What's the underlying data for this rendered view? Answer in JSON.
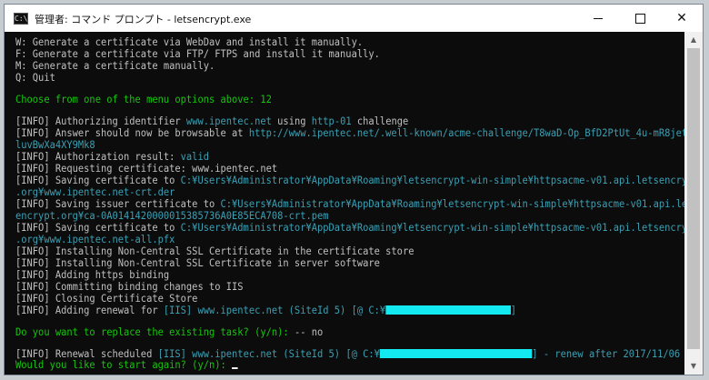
{
  "window": {
    "title": "管理者: コマンド プロンプト - letsencrypt.exe",
    "app_icon": "C:\\",
    "controls": {
      "minimize": "minimize-icon",
      "maximize": "maximize-icon",
      "close": "close-icon"
    },
    "close_glyph": "✕"
  },
  "scrollbar": {
    "up_glyph": "▲",
    "down_glyph": "▼"
  },
  "colors": {
    "background": "#0c0c0c",
    "text": "#c0c0c0",
    "prompt_green": "#16c60c",
    "url_teal": "#3aa0b4",
    "redaction_cyan": "#12e9f1"
  },
  "console": {
    "menu": [
      "W: Generate a certificate via WebDav and install it manually.",
      "F: Generate a certificate via FTP/ FTPS and install it manually.",
      "M: Generate a certificate manually.",
      "Q: Quit"
    ],
    "choose_prompt": "Choose from one of the menu options above: 12",
    "authorizing": {
      "prefix": "[INFO] Authorizing identifier ",
      "host": "www.ipentec.net",
      "mid": " using ",
      "method": "http-01",
      "suffix": " challenge"
    },
    "answer": {
      "prefix": "[INFO] Answer should now be browsable at ",
      "url_part1": "http://www.ipentec.net/.well-known/acme-challenge/T8waD-Op_BfD2PtUt_4u-mR8jetsn",
      "url_part2": "luvBwXa4XY9Mk8"
    },
    "auth_result": {
      "prefix": "[INFO] Authorization result: ",
      "value": "valid"
    },
    "requesting": "[INFO] Requesting certificate: www.ipentec.net",
    "saving_cert": {
      "prefix": "[INFO] Saving certificate to ",
      "path_part1": "C:¥Users¥Administrator¥AppData¥Roaming¥letsencrypt-win-simple¥httpsacme-v01.api.letsencrypt",
      "path_part2": ".org¥www.ipentec.net-crt.der"
    },
    "saving_issuer": {
      "prefix": "[INFO] Saving issuer certificate to ",
      "path_part1": "C:¥Users¥Administrator¥AppData¥Roaming¥letsencrypt-win-simple¥httpsacme-v01.api.lets",
      "path_part2": "encrypt.org¥ca-0A0141420000015385736A0E85ECA708-crt.pem"
    },
    "saving_pfx": {
      "prefix": "[INFO] Saving certificate to ",
      "path_part1": "C:¥Users¥Administrator¥AppData¥Roaming¥letsencrypt-win-simple¥httpsacme-v01.api.letsencrypt",
      "path_part2": ".org¥www.ipentec.net-all.pfx"
    },
    "installing_store": "[INFO] Installing Non-Central SSL Certificate in the certificate store",
    "installing_server": "[INFO] Installing Non-Central SSL Certificate in server software",
    "adding_binding": "[INFO] Adding https binding",
    "committing": "[INFO] Committing binding changes to IIS",
    "closing_store": "[INFO] Closing Certificate Store",
    "adding_renewal": {
      "prefix": "[INFO] Adding renewal for ",
      "details": "[IIS] www.ipentec.net (SiteId 5) [@ C:¥",
      "close": "]"
    },
    "replace_prompt": {
      "question": "Do you want to replace the existing task? (y/n): ",
      "answer": "-- no"
    },
    "renewal_scheduled": {
      "prefix": "[INFO] Renewal scheduled ",
      "details": "[IIS] www.ipentec.net (SiteId 5) [@ C:¥",
      "suffix": "] - renew after 2017/11/06"
    },
    "start_again_prompt": "Would you like to start again? (y/n): "
  }
}
